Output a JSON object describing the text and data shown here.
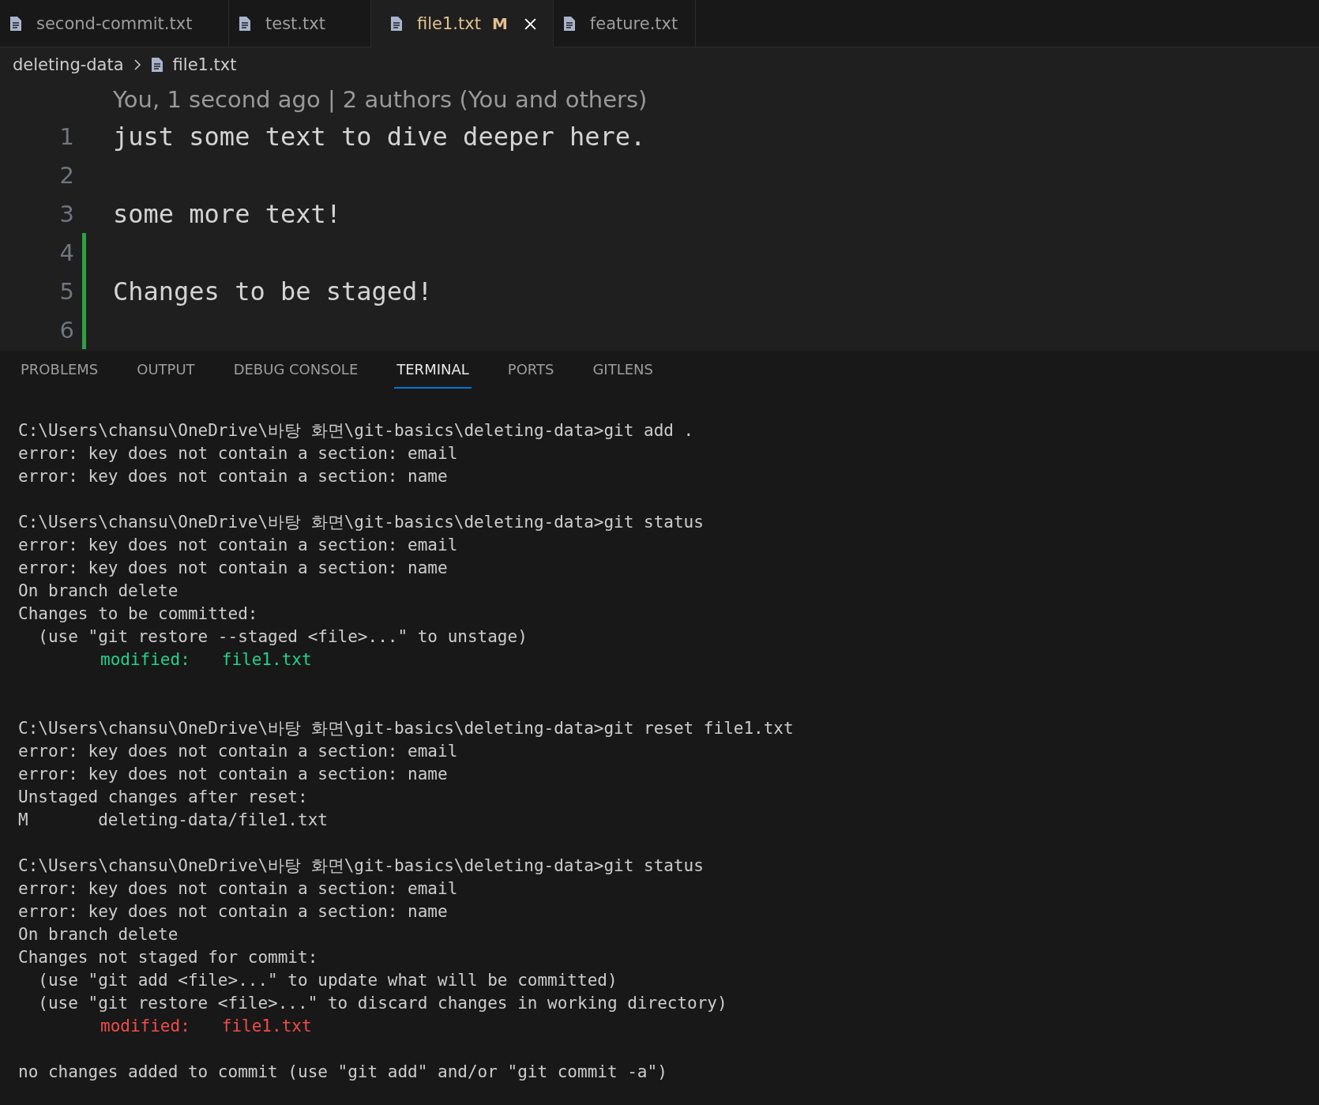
{
  "tabs": [
    {
      "label": "second-commit.txt",
      "selected": false,
      "modified": false
    },
    {
      "label": "test.txt",
      "selected": false,
      "modified": false
    },
    {
      "label": "file1.txt",
      "selected": true,
      "modified": true,
      "badge": "M"
    },
    {
      "label": "feature.txt",
      "selected": false,
      "modified": false
    }
  ],
  "breadcrumb": {
    "folder": "deleting-data",
    "file": "file1.txt"
  },
  "editor": {
    "blame": "You, 1 second ago | 2 authors (You and others)",
    "lines": [
      {
        "number": "1",
        "text": "just some text to dive deeper here.",
        "changed": false
      },
      {
        "number": "2",
        "changed": false
      },
      {
        "number": "3",
        "text": "some more text!",
        "changed": false
      },
      {
        "number": "4",
        "changed": true
      },
      {
        "number": "5",
        "text": "Changes to be staged!",
        "changed": true
      },
      {
        "number": "6",
        "changed": true
      }
    ]
  },
  "panel_tabs": [
    {
      "label": "PROBLEMS",
      "selected": false
    },
    {
      "label": "OUTPUT",
      "selected": false
    },
    {
      "label": "DEBUG CONSOLE",
      "selected": false
    },
    {
      "label": "TERMINAL",
      "selected": true
    },
    {
      "label": "PORTS",
      "selected": false
    },
    {
      "label": "GITLENS",
      "selected": false
    }
  ],
  "terminal": [
    {
      "kind": "blank"
    },
    {
      "kind": "text",
      "text": "C:\\Users\\chansu\\OneDrive\\바탕 화면\\git-basics\\deleting-data>git add ."
    },
    {
      "kind": "text",
      "text": "error: key does not contain a section: email"
    },
    {
      "kind": "text",
      "text": "error: key does not contain a section: name"
    },
    {
      "kind": "blank"
    },
    {
      "kind": "text",
      "text": "C:\\Users\\chansu\\OneDrive\\바탕 화면\\git-basics\\deleting-data>git status"
    },
    {
      "kind": "text",
      "text": "error: key does not contain a section: email"
    },
    {
      "kind": "text",
      "text": "error: key does not contain a section: name"
    },
    {
      "kind": "text",
      "text": "On branch delete"
    },
    {
      "kind": "text",
      "text": "Changes to be committed:"
    },
    {
      "kind": "text",
      "text": "  (use \"git restore --staged <file>...\" to unstage)"
    },
    {
      "kind": "modified",
      "label": "modified:",
      "file": "file1.txt",
      "color": "#23d18b"
    },
    {
      "kind": "blank"
    },
    {
      "kind": "blank"
    },
    {
      "kind": "text",
      "text": "C:\\Users\\chansu\\OneDrive\\바탕 화면\\git-basics\\deleting-data>git reset file1.txt"
    },
    {
      "kind": "text",
      "text": "error: key does not contain a section: email"
    },
    {
      "kind": "text",
      "text": "error: key does not contain a section: name"
    },
    {
      "kind": "text",
      "text": "Unstaged changes after reset:"
    },
    {
      "kind": "text",
      "text": "M       deleting-data/file1.txt"
    },
    {
      "kind": "blank"
    },
    {
      "kind": "text",
      "text": "C:\\Users\\chansu\\OneDrive\\바탕 화면\\git-basics\\deleting-data>git status"
    },
    {
      "kind": "text",
      "text": "error: key does not contain a section: email"
    },
    {
      "kind": "text",
      "text": "error: key does not contain a section: name"
    },
    {
      "kind": "text",
      "text": "On branch delete"
    },
    {
      "kind": "text",
      "text": "Changes not staged for commit:"
    },
    {
      "kind": "text",
      "text": "  (use \"git add <file>...\" to update what will be committed)"
    },
    {
      "kind": "text",
      "text": "  (use \"git restore <file>...\" to discard changes in working directory)"
    },
    {
      "kind": "modified",
      "label": "modified:",
      "file": "file1.txt",
      "color": "#f14c4c"
    },
    {
      "kind": "blank"
    },
    {
      "kind": "text",
      "text": "no changes added to commit (use \"git add\" and/or \"git commit -a\")"
    }
  ]
}
